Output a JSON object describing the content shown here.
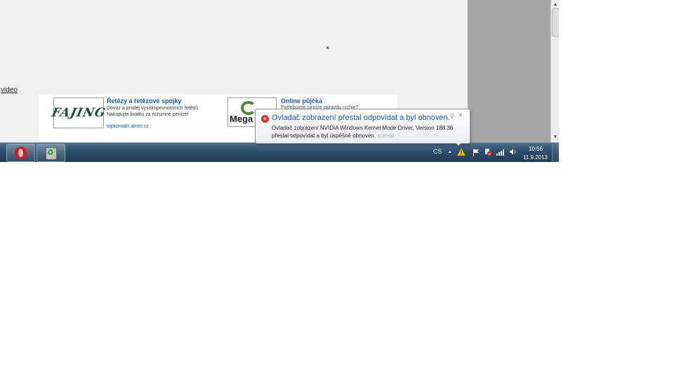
{
  "page": {
    "close_glyph": "×",
    "video_link": "video"
  },
  "ads": [
    {
      "logo_text": "FAJING",
      "title": "Řetězy a řetězové spojky",
      "body": "Dovoz a prodej vysokopevnostních řetězů Nakupujte kvalitu za rozumné peníze!",
      "url": "topkontakt.idnes.cz"
    },
    {
      "logo_text": "Mega",
      "title": "Online půjčka",
      "body": "Potřebujete peníze opravdu rychle?"
    }
  ],
  "notification": {
    "title": "Ovladač zobrazení přestal odpovídat a byl obnoven.",
    "body": "Ovladač zobrazení NVIDIA Windows Kernel Mode Driver, Version 188.36 přestal odpovídat a byl úspěšně obnoven.",
    "ghost_suffix": "inzerát",
    "close_glyph": "×",
    "pin_glyph": "⚲",
    "error_glyph": "×"
  },
  "taskbar": {
    "language": "CS",
    "tray_expand": "▲",
    "clock_time": "10:56",
    "clock_date": "11.9.2013"
  },
  "icons": [
    "close-icon",
    "opera-icon",
    "recycle-bin-icon",
    "error-icon",
    "warning-icon",
    "action-center-flag-icon",
    "network-icon",
    "volume-icon",
    "signal-icon",
    "pin-icon"
  ],
  "colors": {
    "taskbar": "#2d4c6c",
    "link": "#1757a6",
    "balloon_title": "#1e4fa3",
    "error": "#d9362a"
  }
}
